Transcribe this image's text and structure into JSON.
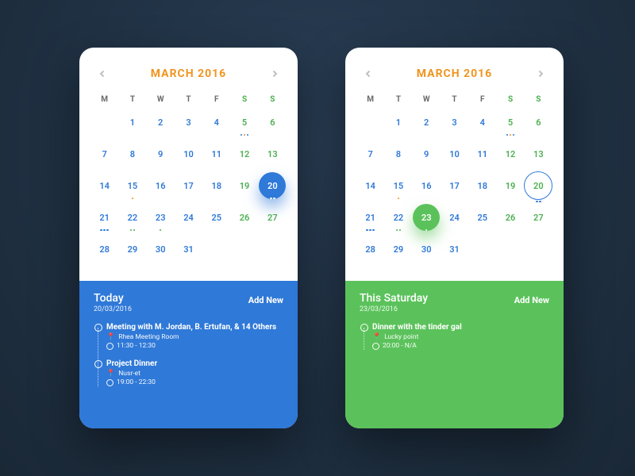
{
  "month_label": "MARCH 2016",
  "days_of_week": [
    "M",
    "T",
    "W",
    "T",
    "F",
    "S",
    "S"
  ],
  "cal": {
    "leading_blanks": 1,
    "days": 31,
    "weekend_start": 6,
    "events": {
      "5": [
        "b",
        "o",
        "b"
      ],
      "15": [
        "o"
      ],
      "20": [
        "b",
        "b"
      ],
      "21": [
        "b",
        "b",
        "b"
      ],
      "22": [
        "g",
        "g"
      ],
      "23": [
        "g"
      ]
    }
  },
  "left": {
    "selected": 20,
    "pill": "blue",
    "ring": null,
    "panel": {
      "color": "blue",
      "title": "Today",
      "date": "20/03/2016",
      "add": "Add New",
      "events": [
        {
          "title": "Meeting with M. Jordan, B. Ertufan, & 14 Others",
          "loc": "Rhea Meeting Room",
          "time": "11:30 - 12:30"
        },
        {
          "title": "Project Dinner",
          "loc": "Nusr-et",
          "time": "19:00 - 22:30"
        }
      ]
    }
  },
  "right": {
    "selected": 23,
    "pill": "green",
    "ring": 20,
    "panel": {
      "color": "green",
      "title": "This Saturday",
      "date": "23/03/2016",
      "add": "Add New",
      "events": [
        {
          "title": "Dinner with the tinder gal",
          "loc": "Lucky point",
          "time": "20:00 - N/A"
        }
      ]
    }
  }
}
